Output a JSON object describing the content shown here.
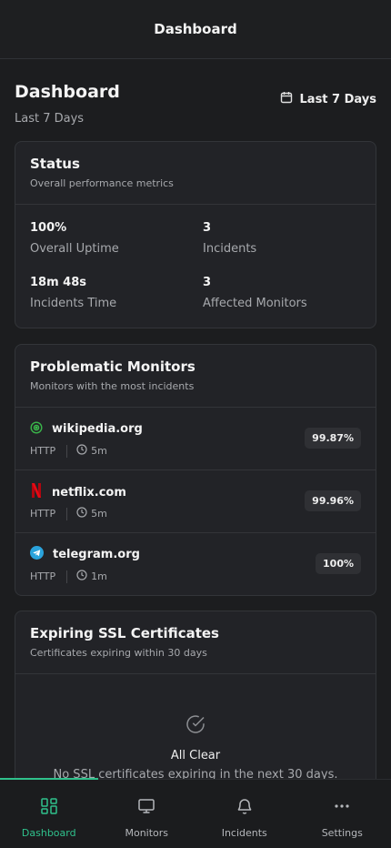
{
  "topbar": {
    "title": "Dashboard"
  },
  "header": {
    "title": "Dashboard",
    "subtitle": "Last 7 Days",
    "range_button": {
      "label": "Last 7 Days",
      "icon": "calendar-icon"
    }
  },
  "status_card": {
    "title": "Status",
    "description": "Overall performance metrics",
    "metrics": [
      {
        "value": "100%",
        "label": "Overall Uptime"
      },
      {
        "value": "3",
        "label": "Incidents"
      },
      {
        "value": "18m 48s",
        "label": "Incidents Time"
      },
      {
        "value": "3",
        "label": "Affected Monitors"
      }
    ]
  },
  "problematic_card": {
    "title": "Problematic Monitors",
    "description": "Monitors with the most incidents",
    "monitors": [
      {
        "name": "wikipedia.org",
        "type": "HTTP",
        "interval": "5m",
        "uptime": "99.87%",
        "icon": "wikipedia-favicon-icon",
        "color": "#3ab54a"
      },
      {
        "name": "netflix.com",
        "type": "HTTP",
        "interval": "5m",
        "uptime": "99.96%",
        "icon": "netflix-logo-icon",
        "color": "#e50914"
      },
      {
        "name": "telegram.org",
        "type": "HTTP",
        "interval": "1m",
        "uptime": "100%",
        "icon": "telegram-logo-icon",
        "color": "#2aa3dc"
      }
    ]
  },
  "ssl_card": {
    "title": "Expiring SSL Certificates",
    "description": "Certificates expiring within 30 days",
    "empty_title": "All Clear",
    "empty_text": "No SSL certificates expiring in the next 30 days."
  },
  "bottom_nav": {
    "active_color": "#2fc18c",
    "items": [
      {
        "label": "Dashboard",
        "icon": "dashboard-grid-icon",
        "active": true
      },
      {
        "label": "Monitors",
        "icon": "monitor-icon",
        "active": false
      },
      {
        "label": "Incidents",
        "icon": "bell-icon",
        "active": false
      },
      {
        "label": "Settings",
        "icon": "more-dots-icon",
        "active": false
      }
    ]
  }
}
